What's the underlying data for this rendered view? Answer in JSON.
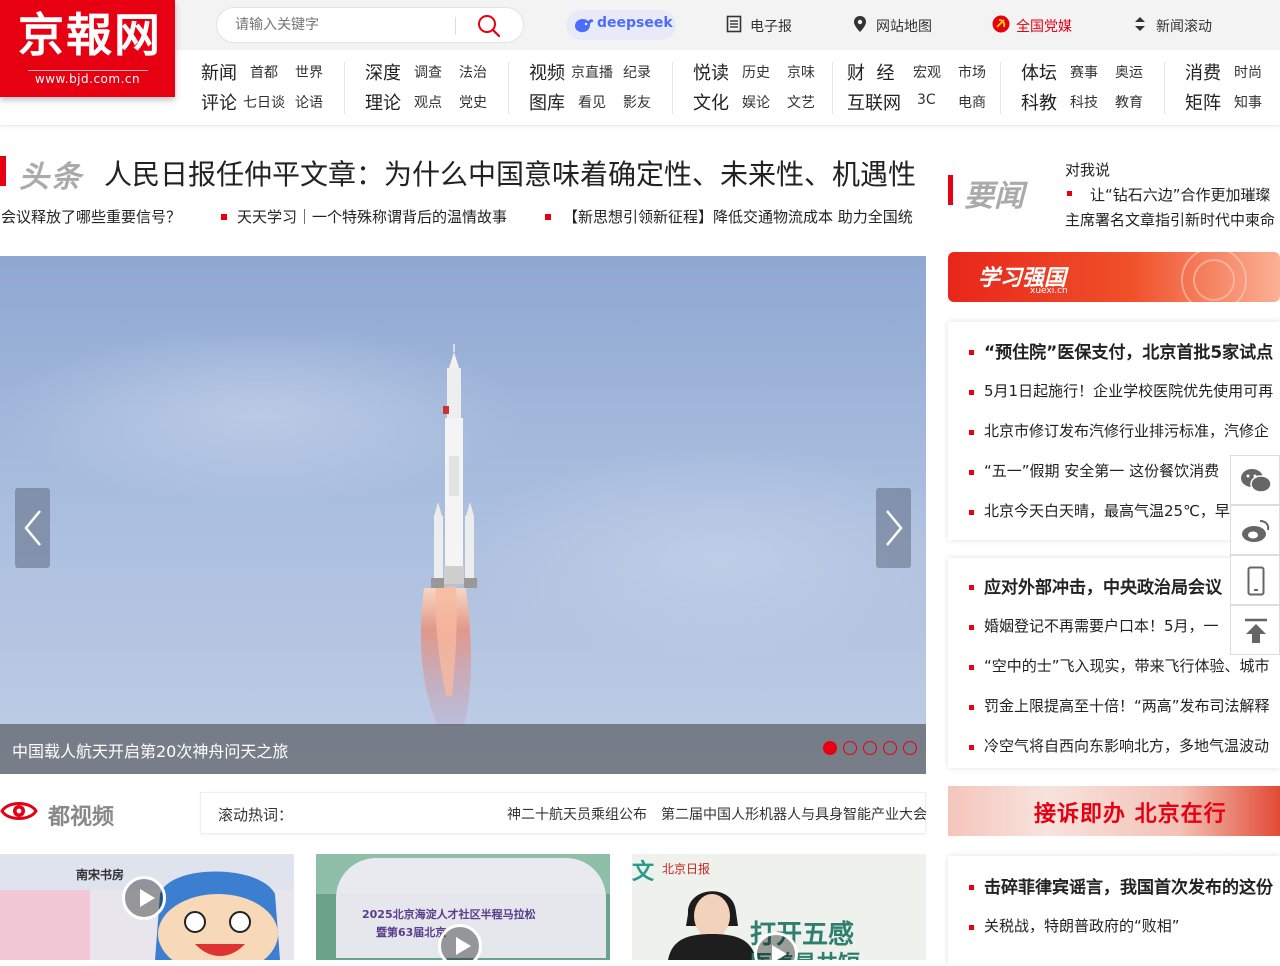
{
  "brand": {
    "logo_text": "京報网",
    "url": "www.bjd.com.cn",
    "accent": "#e60012"
  },
  "search": {
    "placeholder": "请输入关键字"
  },
  "deepseek": {
    "label": "deepseek"
  },
  "top_links": [
    "电子报",
    "网站地图",
    "全国党媒",
    "新闻滚动"
  ],
  "nav": [
    {
      "row1": [
        "新闻",
        "首都",
        "世界"
      ],
      "row2": [
        "评论",
        "七日谈",
        "论语"
      ]
    },
    {
      "row1": [
        "深度",
        "调查",
        "法治"
      ],
      "row2": [
        "理论",
        "观点",
        "党史"
      ]
    },
    {
      "row1": [
        "视频",
        "京直播",
        "纪录"
      ],
      "row2": [
        "图库",
        "看见",
        "影友"
      ]
    },
    {
      "row1": [
        "悦读",
        "历史",
        "京味"
      ],
      "row2": [
        "文化",
        "娱论",
        "文艺"
      ]
    },
    {
      "row1": [
        "财  经",
        "宏观",
        "市场"
      ],
      "row2": [
        "互联网",
        "3C",
        "电商"
      ]
    },
    {
      "row1": [
        "体坛",
        "赛事",
        "奥运"
      ],
      "row2": [
        "科教",
        "科技",
        "教育"
      ]
    },
    {
      "row1": [
        "消费",
        "时尚",
        ""
      ],
      "row2": [
        "矩阵",
        "知事",
        ""
      ]
    }
  ],
  "headline": {
    "tag": "头条",
    "title": "人民日报任仲平文章：为什么中国意味着确定性、未来性、机遇性",
    "subs": [
      "局会议释放了哪些重要信号？",
      "天天学习｜一个特殊称谓背后的温情故事",
      "【新思想引领新征程】降低交通物流成本 助力全国统"
    ]
  },
  "carousel": {
    "caption": "中国载人航天开启第20次神舟问天之旅",
    "dots": 5,
    "active": 0
  },
  "video": {
    "title": "都视频",
    "scroll_label": "滚动热词：",
    "scroll_items": [
      "神二十航天员乘组公布",
      "第二届中国人形机器人与具身智能产业大会"
    ],
    "thumb1_sign": "南宋书房",
    "thumb2_lines": [
      "2025北京海淀人才社区半程马拉松",
      "暨第63届北京"
    ],
    "thumb3_badge": "北京日报",
    "thumb3_text": [
      "打开五感",
      "医美是井短"
    ]
  },
  "yaowen": {
    "tag": "要闻",
    "line1": "对我说",
    "line2": "让“钻石六边”合作更加璀璨",
    "line3": "主席署名文章指引新时代中柬命"
  },
  "xuexi": {
    "text": "学习强国",
    "sub": "xuexi.cn"
  },
  "news_group1": [
    "“预住院”医保支付，北京首批5家试点",
    "5月1日起施行！企业学校医院优先使用可再",
    "北京市修订发布汽修行业排污标准，汽修企",
    "“五一”假期 安全第一 这份餐饮消费",
    "北京今天白天晴，最高气温25℃，早"
  ],
  "news_group2": [
    "应对外部冲击，中央政治局会议",
    "婚姻登记不再需要户口本！5月，一",
    "“空中的士”飞入现实，带来飞行体验、城市",
    "罚金上限提高至十倍！“两高”发布司法解释",
    "冷空气将自西向东影响北方，多地气温波动"
  ],
  "jiesu": {
    "text": "接诉即办 北京在行"
  },
  "news_group3": [
    "击碎菲律宾谣言，我国首次发布的这份",
    "关税战，特朗普政府的“败相”"
  ],
  "side_icons": [
    "wechat-icon",
    "weibo-icon",
    "mobile-icon",
    "back-to-top-icon"
  ]
}
